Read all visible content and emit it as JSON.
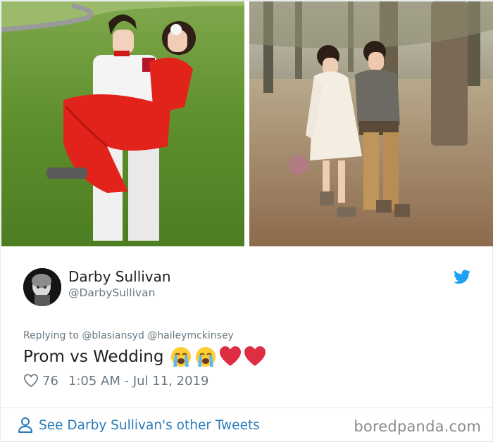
{
  "photos": {
    "left": {
      "subject": "prom photo"
    },
    "right": {
      "subject": "wedding photo"
    }
  },
  "tweet": {
    "author_name": "Darby Sullivan",
    "author_handle": "@DarbySullivan",
    "reply_prefix": "Replying to",
    "reply_mentions": [
      "@blasiansyd",
      "@haileymckinsey"
    ],
    "text": "Prom vs Wedding",
    "emojis": [
      "loudly-crying-face",
      "loudly-crying-face",
      "red-heart",
      "red-heart"
    ],
    "likes": "76",
    "timestamp": "1:05 AM - Jul 11, 2019"
  },
  "footer": {
    "see_more_label": "See Darby Sullivan's other Tweets",
    "watermark": "boredpanda.com"
  },
  "colors": {
    "twitter_blue": "#1da1f2",
    "link_blue": "#2b7bb9",
    "secondary_text": "#697882",
    "heart_red": "#e0245e"
  }
}
